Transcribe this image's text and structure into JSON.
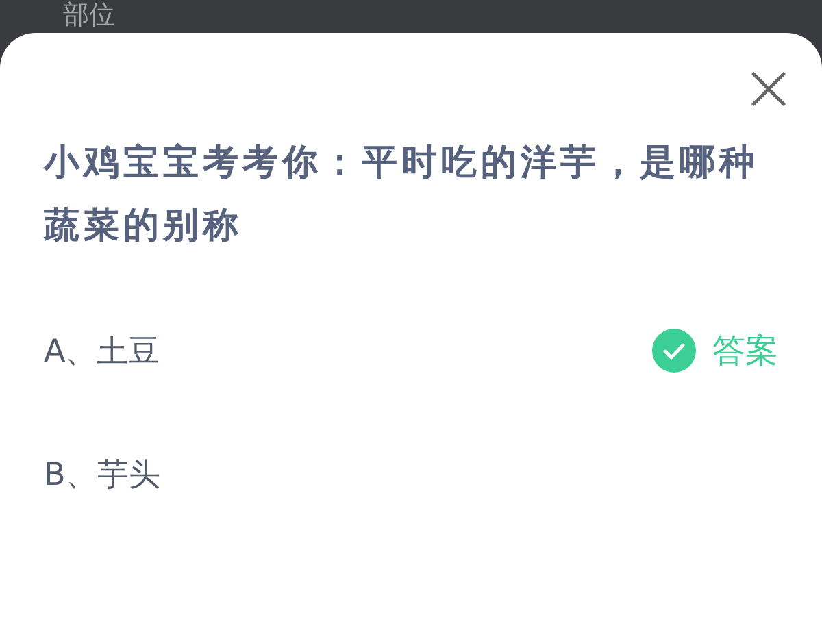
{
  "background": {
    "heading": "部位"
  },
  "sheet": {
    "question": "小鸡宝宝考考你：平时吃的洋芋，是哪种蔬菜的别称",
    "options": [
      {
        "label": "A、土豆",
        "correct": true
      },
      {
        "label": "B、芋头",
        "correct": false
      }
    ],
    "answer_label": "答案"
  }
}
